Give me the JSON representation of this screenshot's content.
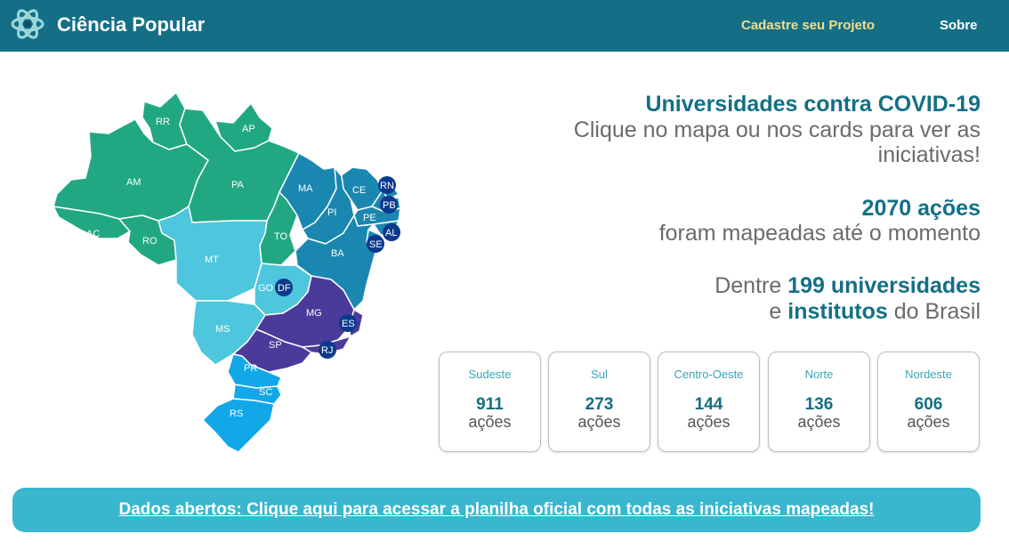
{
  "header": {
    "brand": "Ciência Popular",
    "logo_icon": "atom-logo-icon",
    "nav": {
      "project": "Cadastre seu Projeto",
      "about": "Sobre"
    },
    "colors": {
      "bar": "#146f86",
      "project_link": "#f2dd8a"
    }
  },
  "map": {
    "colors": {
      "norte": "#21a882",
      "nordeste": "#1a87b0",
      "centro_oeste": "#4ec6dd",
      "sudeste": "#4a3a9a",
      "sul": "#12a8e8",
      "badge": "#0b3a8c"
    },
    "states": {
      "RR": "RR",
      "AP": "AP",
      "AM": "AM",
      "PA": "PA",
      "AC": "AC",
      "RO": "RO",
      "TO": "TO",
      "MA": "MA",
      "CE": "CE",
      "PI": "PI",
      "RN": "RN",
      "PB": "PB",
      "PE": "PE",
      "AL": "AL",
      "SE": "SE",
      "BA": "BA",
      "MT": "MT",
      "GO": "GO",
      "DF": "DF",
      "MS": "MS",
      "MG": "MG",
      "ES": "ES",
      "SP": "SP",
      "RJ": "RJ",
      "PR": "PR",
      "SC": "SC",
      "RS": "RS"
    }
  },
  "intro": {
    "title": "Universidades contra COVID-19",
    "subtitle_line1": "Clique no mapa ou nos cards para ver as",
    "subtitle_line2": "iniciativas!"
  },
  "stats": {
    "actions_count": "2070 ações",
    "actions_sub": "foram mapeadas até o momento",
    "unis_prefix": "Dentre",
    "unis_count": "199 universidades",
    "unis_connector": "e",
    "unis_institutes": "institutos",
    "unis_suffix": "do Brasil"
  },
  "cards": [
    {
      "region": "Sudeste",
      "count": "911",
      "unit": "ações"
    },
    {
      "region": "Sul",
      "count": "273",
      "unit": "ações"
    },
    {
      "region": "Centro-Oeste",
      "count": "144",
      "unit": "ações"
    },
    {
      "region": "Norte",
      "count": "136",
      "unit": "ações"
    },
    {
      "region": "Nordeste",
      "count": "606",
      "unit": "ações"
    }
  ],
  "banner": {
    "link_text": "Dados abertos: Clique aqui para acessar a planilha oficial com todas as iniciativas mapeadas!",
    "color": "#3ab6ce"
  }
}
